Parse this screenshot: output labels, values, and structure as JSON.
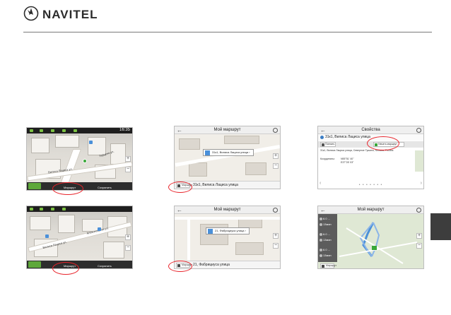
{
  "brand": {
    "name": "NAVITEL",
    "accent_color": "#e8232a",
    "logo_icon": "navitel-compass-icon"
  },
  "screen_1": {
    "time": "16:35",
    "street_1": "Герцена ул.",
    "street_2": "Вилиса Лациса ул.",
    "button_left": "Маршрут",
    "button_right": "Сохранить"
  },
  "screen_2": {
    "street_1": "Алексеевская ул.",
    "street_2": "Вилиса Лациса ул.",
    "button_left": "Маршрут",
    "button_right": "Сохранить"
  },
  "screen_3": {
    "title": "Мой маршрут",
    "callout": "31к1, Вилиса Лациса улица",
    "address_button": "Маршрут",
    "address": "31к1, Вилиса Лациса улица"
  },
  "screen_4": {
    "title": "Мой маршрут",
    "callout": "21, Фабрициуса улица",
    "address_button": "Маршрут",
    "address": "21, Фабрициуса улица"
  },
  "screen_5": {
    "title": "Свойства",
    "place_name": "31к1, Вилиса Лациса улица",
    "button_left": "Поехать",
    "button_right": "Начать маршрут",
    "details": "31к1, Вилиса Лациса улица, Северное Тушино, Москва, Россия",
    "coords_label": "Координаты:",
    "lat": "N55°51' 40\"",
    "lon": "E37°26' 03\""
  },
  "screen_6": {
    "title": "Мой маршрут",
    "stats": [
      {
        "distance": "6.0 ...",
        "time": "13мин"
      },
      {
        "distance": "6.0 ...",
        "time": "13мин"
      },
      {
        "distance": "6.0 ...",
        "time": "13мин"
      }
    ],
    "route_button": "Маршрут"
  }
}
